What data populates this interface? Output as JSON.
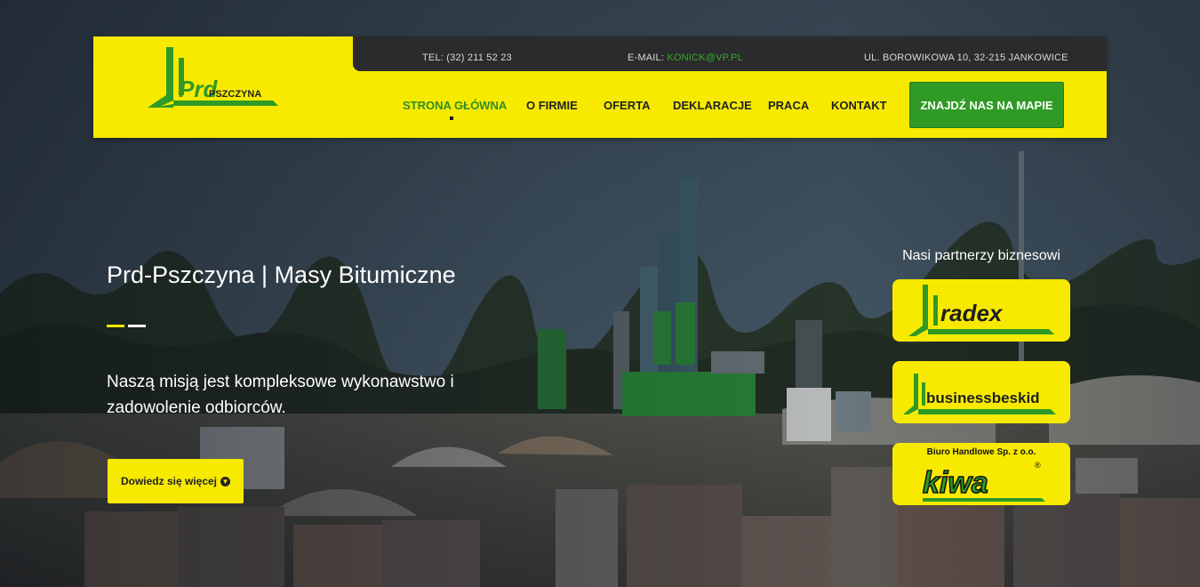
{
  "header": {
    "logo_text": "Prd",
    "logo_sub": "PSZCZYNA",
    "topbar": {
      "tel": "TEL: (32) 211 52 23",
      "email_label": "E-MAIL: ",
      "email_value": "KONICK@VP.PL",
      "address": "UL. BOROWIKOWA 10, 32-215 JANKOWICE"
    },
    "nav": [
      {
        "label": "STRONA GŁÓWNA",
        "active": true
      },
      {
        "label": "O FIRMIE",
        "active": false
      },
      {
        "label": "OFERTA",
        "active": false
      },
      {
        "label": "DEKLARACJE",
        "active": false
      },
      {
        "label": "PRACA",
        "active": false
      },
      {
        "label": "KONTAKT",
        "active": false
      }
    ],
    "map_button": "ZNAJDŹ NAS NA MAPIE"
  },
  "hero": {
    "title": "Prd-Pszczyna | Masy Bitumiczne",
    "text": "Naszą misją jest kompleksowe wykonawstwo i zadowolenie odbiorców.",
    "button": "Dowiedz się więcej"
  },
  "partners": {
    "title": "Nasi partnerzy biznesowi",
    "items": [
      {
        "name": "radex"
      },
      {
        "name": "businessbeskid"
      },
      {
        "name": "kiwa",
        "top_line": "Biuro Handlowe Sp. z o.o."
      }
    ]
  },
  "colors": {
    "brand_yellow": "#f7ea00",
    "brand_green": "#2f9a26",
    "topbar_dark": "#2b2b2b"
  },
  "icons": [
    "circle-arrow-down-icon"
  ]
}
